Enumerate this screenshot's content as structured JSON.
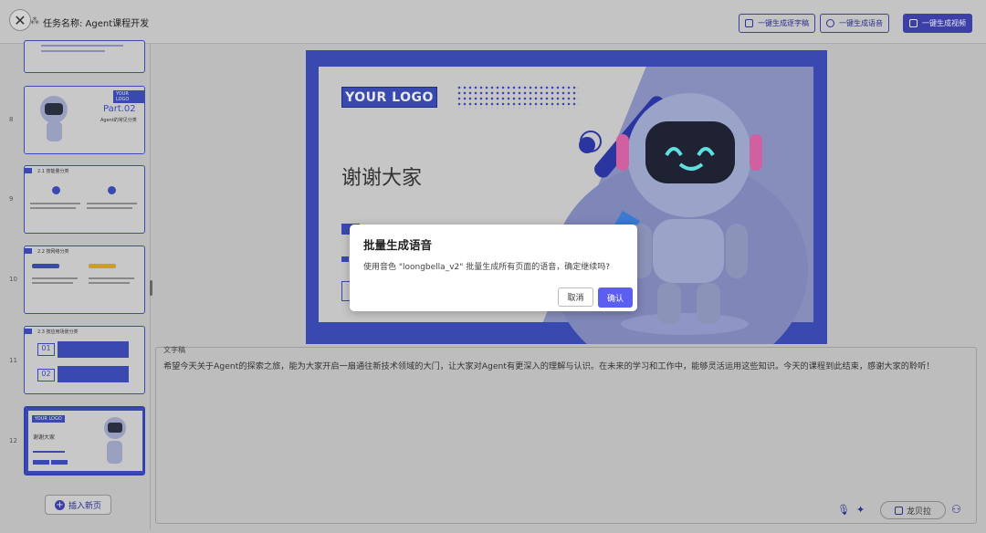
{
  "header": {
    "close_icon": "close-icon",
    "collapse_icon": "collapse-icon",
    "task_title": "任务名称: Agent课程开发",
    "buttons": {
      "subtitle": "一键生成逐字稿",
      "voice": "一键生成语音",
      "video": "一键生成视频"
    }
  },
  "sidebar": {
    "slides": [
      {
        "num": "8",
        "logo": "YOUR LOGO",
        "part": "Part.02",
        "sub": "Agent的常见分类"
      },
      {
        "num": "9",
        "heading": "2.1 按能量分类"
      },
      {
        "num": "10",
        "heading": "2.2 按网络分类"
      },
      {
        "num": "11",
        "heading": "2.3 按应用场景分类",
        "item1": "01",
        "item2": "02"
      },
      {
        "num": "12",
        "logo": "YOUR LOGO",
        "heading": "谢谢大家"
      }
    ],
    "insert_label": "插入新页"
  },
  "slide": {
    "logo": "YOUR LOGO",
    "title": "谢谢大家"
  },
  "script": {
    "label": "文字稿",
    "text": "希望今天关于Agent的探索之旅，能为大家开启一扇通往新技术领域的大门，让大家对Agent有更深入的理解与认识。在未来的学习和工作中，能够灵活运用这些知识。今天的课程到此结束，感谢大家的聆听！",
    "voice_label": "龙贝拉"
  },
  "modal": {
    "title": "批量生成语音",
    "body": "使用音色 \"loongbella_v2\" 批量生成所有页面的语音，确定继续吗?",
    "cancel": "取消",
    "confirm": "确认"
  },
  "colors": {
    "accent": "#3a49b0",
    "primary_button": "#5b5ef0"
  }
}
